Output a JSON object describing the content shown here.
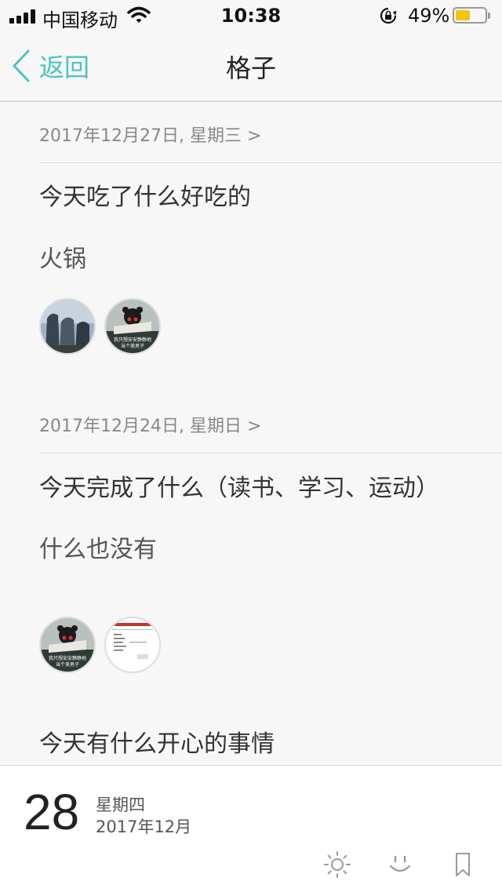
{
  "status_bar": {
    "carrier": "中国移动",
    "time": "10:38",
    "battery_percent": "49%",
    "battery_level": 0.49,
    "icons": [
      "signal-icon",
      "wifi-icon",
      "orientation-lock-icon",
      "battery-icon"
    ]
  },
  "nav": {
    "back_label": "返回",
    "title": "格子"
  },
  "entries": [
    {
      "date": "2017年12月27日, 星期三 >",
      "question": "今天吃了什么好吃的",
      "answer": "火锅"
    },
    {
      "date": "2017年12月24日, 星期日 >",
      "question": "今天完成了什么（读书、学习、运动）",
      "answer": "什么也没有"
    },
    {
      "question": "今天有什么开心的事情"
    }
  ],
  "photo_captions": {
    "bear_line1": "我只想安安静静地",
    "bear_line2": "当个美男子"
  },
  "bottom": {
    "day": "28",
    "weekday": "星期四",
    "year_month": "2017年12月",
    "tools": [
      "sun-icon",
      "smile-icon",
      "bookmark-icon"
    ]
  },
  "colors": {
    "accent": "#4cc3c0",
    "battery": "#f5c400",
    "background": "#f7f7f7"
  }
}
